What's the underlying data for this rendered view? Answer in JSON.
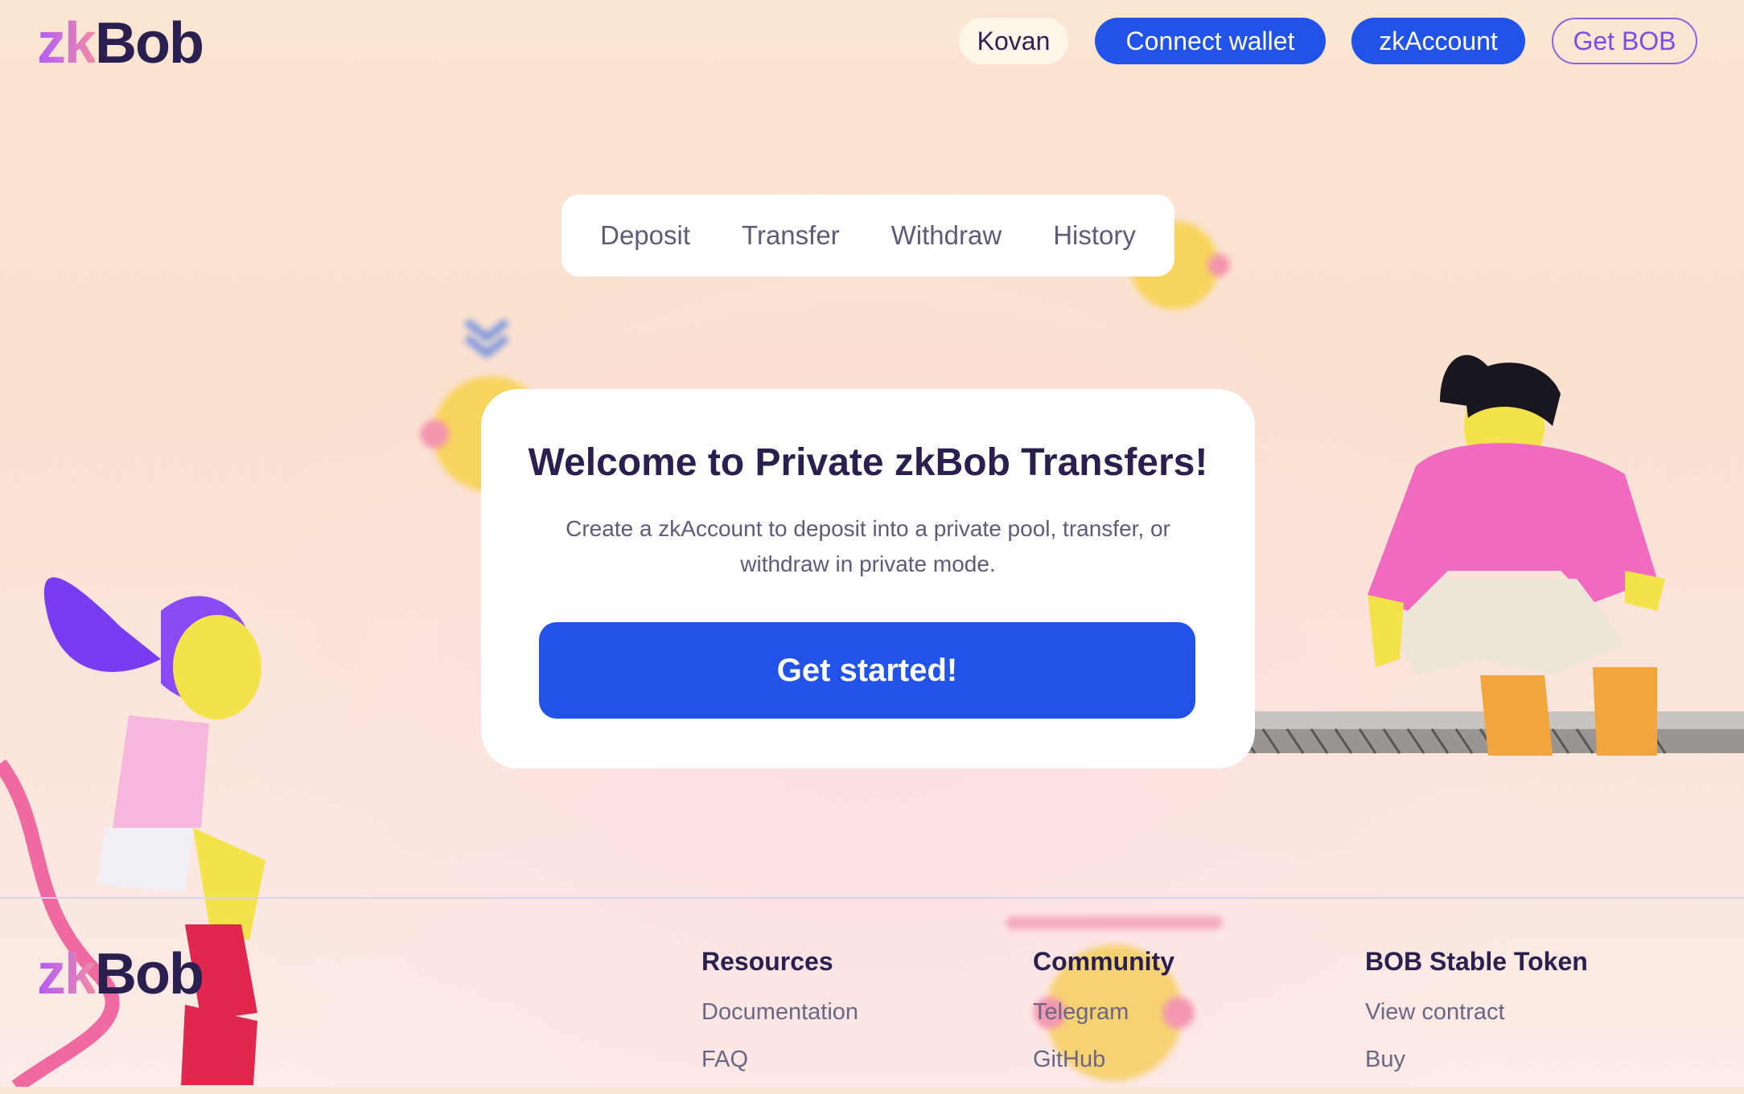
{
  "header": {
    "logo_prefix": "zk",
    "logo_suffix": "Bob",
    "network_label": "Kovan",
    "connect_label": "Connect wallet",
    "zkaccount_label": "zkAccount",
    "getbob_label": "Get BOB"
  },
  "tabs": [
    {
      "label": "Deposit"
    },
    {
      "label": "Transfer"
    },
    {
      "label": "Withdraw"
    },
    {
      "label": "History"
    }
  ],
  "card": {
    "title": "Welcome to Private zkBob Transfers!",
    "description": "Create a zkAccount to deposit into a private pool, transfer, or withdraw in private mode.",
    "cta_label": "Get started!"
  },
  "footer": {
    "logo_prefix": "zk",
    "logo_suffix": "Bob",
    "columns": [
      {
        "heading": "Resources",
        "links": [
          "Documentation",
          "FAQ"
        ]
      },
      {
        "heading": "Community",
        "links": [
          "Telegram",
          "GitHub"
        ]
      },
      {
        "heading": "BOB Stable Token",
        "links": [
          "View contract",
          "Buy"
        ]
      }
    ]
  },
  "colors": {
    "primary": "#2153e8",
    "text_dark": "#2a1f4e",
    "text_muted": "#5e5a78",
    "outline_purple": "#8a62e0"
  }
}
